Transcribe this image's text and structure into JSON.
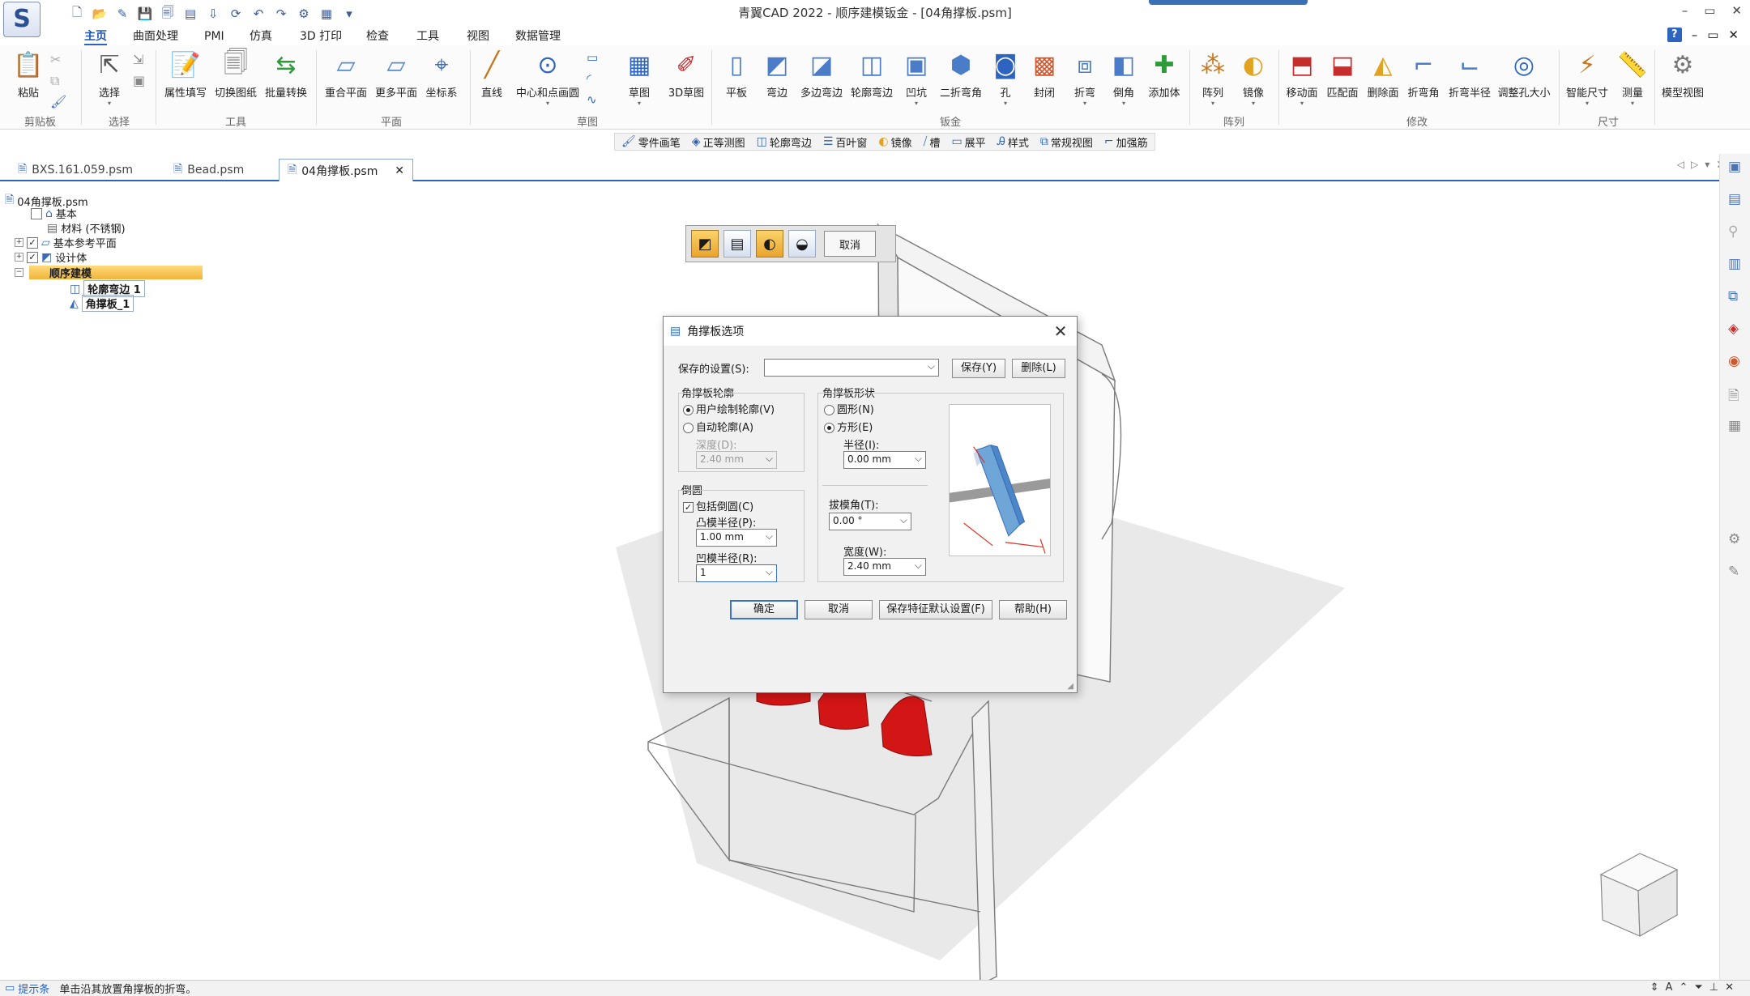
{
  "window": {
    "title": "青翼CAD 2022 - 顺序建模钣金 - [04角撑板.psm]",
    "logo_text": "S",
    "controls": [
      "–",
      "▭",
      "✕"
    ]
  },
  "menu": {
    "tabs": [
      "主页",
      "曲面处理",
      "PMI",
      "仿真",
      "3D 打印",
      "检查",
      "工具",
      "视图",
      "数据管理"
    ],
    "active": "主页"
  },
  "ribbon": {
    "groups": [
      {
        "label": "剪贴板",
        "items": [
          {
            "label": "粘贴",
            "icon": "paste-icon"
          }
        ]
      },
      {
        "label": "选择",
        "items": [
          {
            "label": "选择",
            "icon": "select-icon"
          }
        ]
      },
      {
        "label": "工具",
        "items": [
          {
            "label": "属性填写",
            "icon": "property-icon"
          },
          {
            "label": "切换图纸",
            "icon": "drawing-icon"
          },
          {
            "label": "批量转换",
            "icon": "convert-icon"
          }
        ]
      },
      {
        "label": "平面",
        "items": [
          {
            "label": "重合平面",
            "icon": "plane-icon"
          },
          {
            "label": "更多平面",
            "icon": "planes-icon"
          },
          {
            "label": "坐标系",
            "icon": "coordinate-icon"
          }
        ]
      },
      {
        "label": "草图",
        "items": [
          {
            "label": "直线",
            "icon": "line-icon"
          },
          {
            "label": "中心和点画圆",
            "icon": "circle-icon"
          },
          {
            "label": "草图",
            "icon": "sketch-icon"
          },
          {
            "label": "3D草图",
            "icon": "3d-sketch-icon"
          }
        ]
      },
      {
        "label": "钣金",
        "items": [
          {
            "label": "平板",
            "icon": "tab-icon"
          },
          {
            "label": "弯边",
            "icon": "flange-icon"
          },
          {
            "label": "多边弯边",
            "icon": "multi-flange-icon"
          },
          {
            "label": "轮廓弯边",
            "icon": "contour-flange-icon"
          },
          {
            "label": "凹坑",
            "icon": "dimple-icon"
          },
          {
            "label": "二折弯角",
            "icon": "corner-icon"
          },
          {
            "label": "孔",
            "icon": "hole-icon"
          },
          {
            "label": "封闭",
            "icon": "close-corner-icon"
          },
          {
            "label": "折弯",
            "icon": "bend-icon"
          },
          {
            "label": "倒角",
            "icon": "chamfer-icon"
          },
          {
            "label": "添加体",
            "icon": "add-body-icon"
          }
        ]
      },
      {
        "label": "阵列",
        "items": [
          {
            "label": "阵列",
            "icon": "pattern-icon"
          },
          {
            "label": "镜像",
            "icon": "mirror-icon"
          }
        ]
      },
      {
        "label": "修改",
        "items": [
          {
            "label": "移动面",
            "icon": "move-face-icon"
          },
          {
            "label": "匹配面",
            "icon": "match-face-icon"
          },
          {
            "label": "删除面",
            "icon": "delete-face-icon"
          },
          {
            "label": "折弯角",
            "icon": "bend-angle-icon"
          },
          {
            "label": "折弯半径",
            "icon": "bend-radius-icon"
          },
          {
            "label": "调整孔大小",
            "icon": "resize-hole-icon"
          }
        ]
      },
      {
        "label": "尺寸",
        "items": [
          {
            "label": "智能尺寸",
            "icon": "smart-dim-icon"
          },
          {
            "label": "测量",
            "icon": "measure-icon"
          }
        ]
      },
      {
        "label": "",
        "items": [
          {
            "label": "模型视图",
            "icon": "model-view-icon"
          }
        ]
      }
    ]
  },
  "command_bar": [
    {
      "label": "零件画笔",
      "icon": "part-painter-icon"
    },
    {
      "label": "正等测图",
      "icon": "iso-view-icon"
    },
    {
      "label": "轮廓弯边",
      "icon": "contour-flange-icon"
    },
    {
      "label": "百叶窗",
      "icon": "louver-icon"
    },
    {
      "label": "镜像",
      "icon": "mirror-icon"
    },
    {
      "label": "槽",
      "icon": "slot-icon"
    },
    {
      "label": "展平",
      "icon": "flatten-icon"
    },
    {
      "label": "样式",
      "icon": "style-icon"
    },
    {
      "label": "常规视图",
      "icon": "view-icon"
    },
    {
      "label": "加强筋",
      "icon": "rib-icon"
    }
  ],
  "doc_tabs": [
    {
      "label": "BXS.161.059.psm",
      "active": false
    },
    {
      "label": "Bead.psm",
      "active": false
    },
    {
      "label": "04角撑板.psm",
      "active": true
    }
  ],
  "tree": {
    "root": "04角撑板.psm",
    "nodes": [
      {
        "label": "基本",
        "level": 1
      },
      {
        "label": "材料 (不锈钢)",
        "level": 2
      },
      {
        "label": "基本参考平面",
        "level": 1
      },
      {
        "label": "设计体",
        "level": 1
      },
      {
        "label": "顺序建模",
        "level": 1
      },
      {
        "label": "轮廓弯边 1",
        "level": 3
      },
      {
        "label": "角撑板_1",
        "level": 3
      }
    ]
  },
  "mini_toolbar": {
    "cancel": "取消"
  },
  "dialog": {
    "title": "角撑板选项",
    "saved_settings_label": "保存的设置(S):",
    "saved_settings_value": "",
    "save_btn": "保存(Y)",
    "delete_btn": "删除(L)",
    "profile_group": "角撑板轮廓",
    "radio_user": "用户绘制轮廓(V)",
    "radio_auto": "自动轮廓(A)",
    "depth_label": "深度(D):",
    "depth_value": "2.40 mm",
    "round_group": "倒圆",
    "include_round": "包括倒圆(C)",
    "punch_label": "凸模半径(P):",
    "punch_value": "1.00 mm",
    "die_label": "凹模半径(R):",
    "die_value": "1",
    "shape_group": "角撑板形状",
    "radio_round": "圆形(N)",
    "radio_square": "方形(E)",
    "radius_label": "半径(I):",
    "radius_value": "0.00 mm",
    "draft_label": "拔模角(T):",
    "draft_value": "0.00 °",
    "width_label": "宽度(W):",
    "width_value": "2.40 mm",
    "ok": "确定",
    "cancel": "取消",
    "save_default": "保存特征默认设置(F)",
    "help": "帮助(H)"
  },
  "status": {
    "tag": "提示条",
    "text": "单击沿其放置角撑板的折弯。"
  },
  "colors": {
    "accent": "#2d64c0",
    "part_red": "#d21515",
    "highlight": "#f5c252"
  }
}
